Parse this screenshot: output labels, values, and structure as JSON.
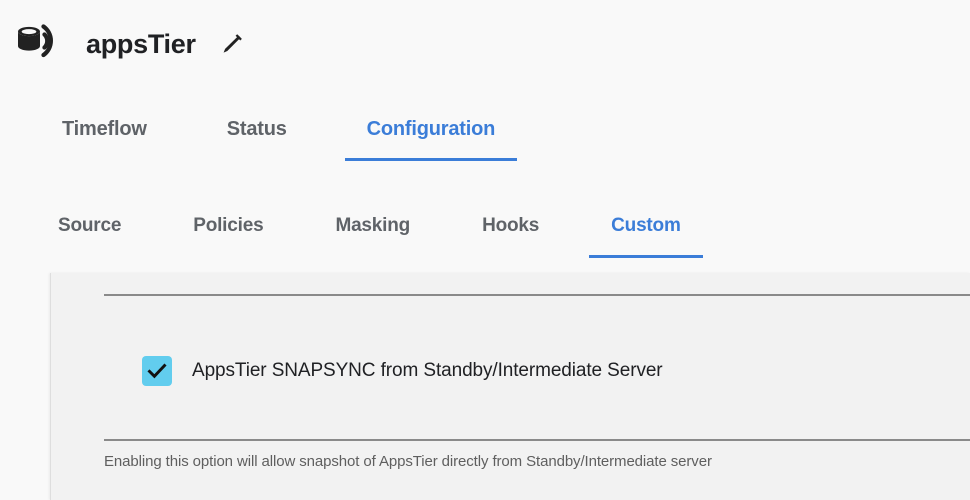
{
  "header": {
    "icon": "dsource-broadcast-icon",
    "title": "appsTier",
    "edit_icon": "pencil-edit-icon"
  },
  "tabs_primary": {
    "items": [
      {
        "label": "Timeflow",
        "active": false
      },
      {
        "label": "Status",
        "active": false
      },
      {
        "label": "Configuration",
        "active": true
      }
    ]
  },
  "tabs_secondary": {
    "items": [
      {
        "label": "Source",
        "active": false
      },
      {
        "label": "Policies",
        "active": false
      },
      {
        "label": "Masking",
        "active": false
      },
      {
        "label": "Hooks",
        "active": false
      },
      {
        "label": "Custom",
        "active": true
      }
    ]
  },
  "panel": {
    "option": {
      "checked": true,
      "check_icon": "checkmark-icon",
      "label": "AppsTier SNAPSYNC from Standby/Intermediate Server"
    },
    "helper_text": "Enabling this option will allow snapshot of AppsTier directly from Standby/Intermediate server"
  },
  "colors": {
    "accent_blue": "#3b7dd8",
    "checkbox_fill": "#62cdee",
    "text_primary": "#202124",
    "text_muted": "#5f6368",
    "panel_bg": "#f2f2f2",
    "page_bg": "#f9f9f9",
    "divider": "#8a8a8a"
  }
}
